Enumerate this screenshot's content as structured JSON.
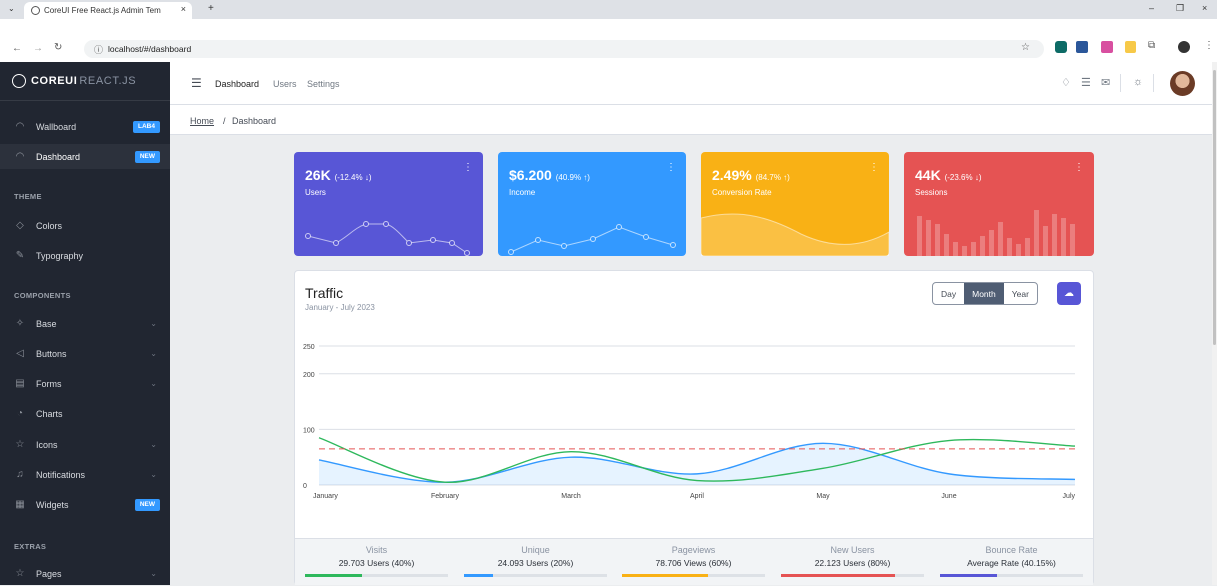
{
  "browser": {
    "tab_title": "CoreUI Free React.js Admin Tem",
    "url": "localhost/#/dashboard",
    "new_tab": "+"
  },
  "sidebar": {
    "brand_bold": "COREUI",
    "brand_light": "REACT.JS",
    "items": [
      {
        "label": "Wallboard",
        "badge": "LAB4"
      },
      {
        "label": "Dashboard",
        "badge": "NEW"
      },
      {
        "label": "Colors"
      },
      {
        "label": "Typography"
      },
      {
        "label": "Base"
      },
      {
        "label": "Buttons"
      },
      {
        "label": "Forms"
      },
      {
        "label": "Charts"
      },
      {
        "label": "Icons"
      },
      {
        "label": "Notifications"
      },
      {
        "label": "Widgets",
        "badge": "NEW"
      },
      {
        "label": "Pages"
      }
    ],
    "sections": {
      "theme": "THEME",
      "components": "COMPONENTS",
      "extras": "EXTRAS"
    }
  },
  "header": {
    "nav": [
      "Dashboard",
      "Users",
      "Settings"
    ]
  },
  "breadcrumb": {
    "home": "Home",
    "sep": "/",
    "current": "Dashboard"
  },
  "widgets": [
    {
      "value": "26K",
      "change": "(-12.4% ↓)",
      "label": "Users",
      "color": "#5856d6"
    },
    {
      "value": "$6.200",
      "change": "(40.9% ↑)",
      "label": "Income",
      "color": "#3399ff"
    },
    {
      "value": "2.49%",
      "change": "(84.7% ↑)",
      "label": "Conversion Rate",
      "color": "#f9b115"
    },
    {
      "value": "44K",
      "change": "(-23.6% ↓)",
      "label": "Sessions",
      "color": "#e55353"
    }
  ],
  "traffic": {
    "title": "Traffic",
    "subtitle": "January - July 2023",
    "periods": [
      "Day",
      "Month",
      "Year"
    ],
    "active_period": "Month"
  },
  "chart_data": {
    "type": "line",
    "categories": [
      "January",
      "February",
      "March",
      "April",
      "May",
      "June",
      "July"
    ],
    "yticks": [
      0,
      100,
      200,
      250
    ],
    "ylim": [
      0,
      250
    ],
    "series": [
      {
        "values": [
          45,
          5,
          50,
          20,
          75,
          20,
          10
        ],
        "color": "#3399ff"
      },
      {
        "values": [
          85,
          5,
          60,
          8,
          30,
          80,
          70
        ],
        "color": "#2eb85c"
      },
      {
        "values": [
          65,
          65,
          65,
          65,
          65,
          65,
          65
        ],
        "color": "#e55353"
      }
    ]
  },
  "stats": [
    {
      "label": "Visits",
      "value": "29.703 Users (40%)",
      "percent": 40,
      "color": "#2eb85c"
    },
    {
      "label": "Unique",
      "value": "24.093 Users (20%)",
      "percent": 20,
      "color": "#3399ff"
    },
    {
      "label": "Pageviews",
      "value": "78.706 Views (60%)",
      "percent": 60,
      "color": "#f9b115"
    },
    {
      "label": "New Users",
      "value": "22.123 Users (80%)",
      "percent": 80,
      "color": "#e55353"
    },
    {
      "label": "Bounce Rate",
      "value": "Average Rate (40.15%)",
      "percent": 40,
      "color": "#5856d6"
    }
  ]
}
